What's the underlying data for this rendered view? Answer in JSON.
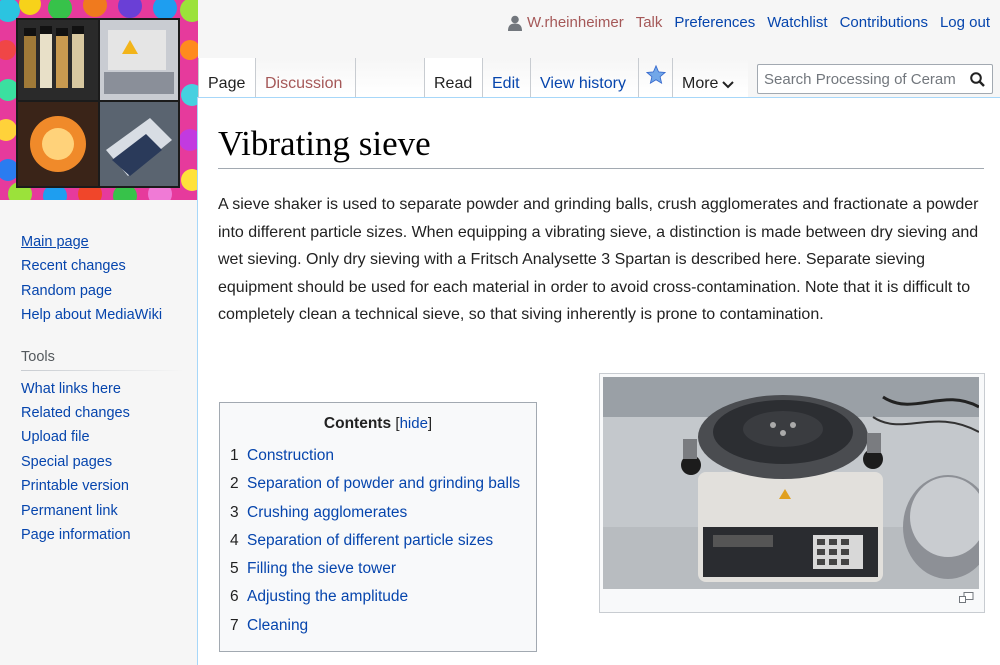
{
  "personal_tools": {
    "username": "W.rheinheimer",
    "talk": "Talk",
    "preferences": "Preferences",
    "watchlist": "Watchlist",
    "contributions": "Contributions",
    "logout": "Log out"
  },
  "tabs": {
    "page": "Page",
    "discussion": "Discussion",
    "read": "Read",
    "edit": "Edit",
    "view_history": "View history",
    "more": "More"
  },
  "search": {
    "placeholder": "Search Processing of Ceram"
  },
  "sidebar": {
    "navigation": [
      {
        "label": "Main page"
      },
      {
        "label": "Recent changes"
      },
      {
        "label": "Random page"
      },
      {
        "label": "Help about MediaWiki"
      }
    ],
    "tools_heading": "Tools",
    "tools": [
      {
        "label": "What links here"
      },
      {
        "label": "Related changes"
      },
      {
        "label": "Upload file"
      },
      {
        "label": "Special pages"
      },
      {
        "label": "Printable version"
      },
      {
        "label": "Permanent link"
      },
      {
        "label": "Page information"
      }
    ]
  },
  "article": {
    "title": "Vibrating sieve",
    "intro": "A sieve shaker is used to separate powder and grinding balls, crush agglomerates and fractionate a powder into different particle sizes. When equipping a vibrating sieve, a distinction is made between dry sieving and wet sieving. Only dry sieving with a Fritsch Analysette 3 Spartan is described here. Separate sieving equipment should be used for each material in order to avoid cross-contamination. Note that it is difficult to completely clean a technical sieve, so that siving inherently is prone to contamination."
  },
  "toc": {
    "title": "Contents",
    "hide_label": "hide",
    "items": [
      {
        "num": "1",
        "label": "Construction"
      },
      {
        "num": "2",
        "label": "Separation of powder and grinding balls"
      },
      {
        "num": "3",
        "label": "Crushing agglomerates"
      },
      {
        "num": "4",
        "label": "Separation of different particle sizes"
      },
      {
        "num": "5",
        "label": "Filling the sieve tower"
      },
      {
        "num": "6",
        "label": "Adjusting the amplitude"
      },
      {
        "num": "7",
        "label": "Cleaning"
      }
    ]
  },
  "icons": {
    "user": "user-icon",
    "watch": "star-icon",
    "more": "chevron-down-icon",
    "search": "search-icon",
    "magnify": "magnify-icon"
  },
  "colors": {
    "link": "#0645ad",
    "new_link": "#a55858",
    "content_border": "#a7d7f9",
    "sidebar_bg": "#f6f6f6"
  }
}
